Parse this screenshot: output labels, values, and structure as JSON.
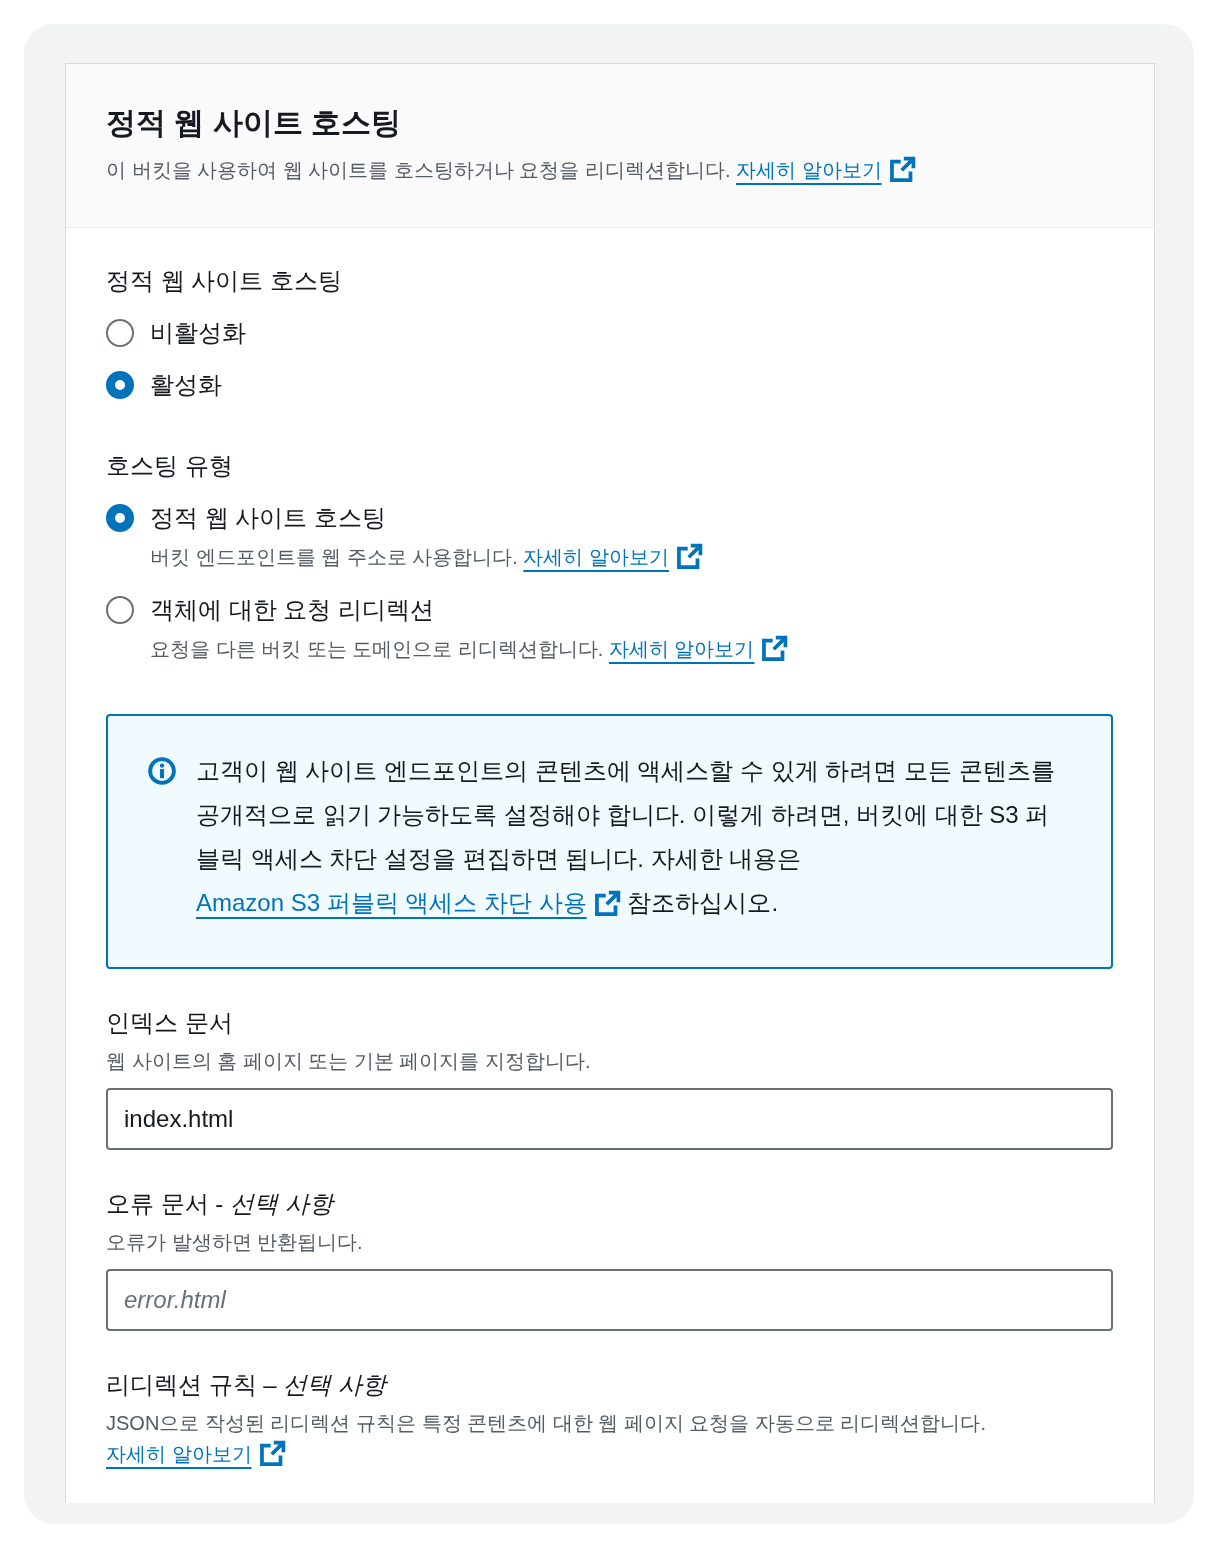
{
  "header": {
    "title": "정적 웹 사이트 호스팅",
    "description": "이 버킷을 사용하여 웹 사이트를 호스팅하거나 요청을 리디렉션합니다.",
    "link": "자세히 알아보기"
  },
  "hosting": {
    "label": "정적 웹 사이트 호스팅",
    "options": [
      {
        "label": "비활성화",
        "selected": false
      },
      {
        "label": "활성화",
        "selected": true
      }
    ]
  },
  "hosting_type": {
    "label": "호스팅 유형",
    "options": [
      {
        "label": "정적 웹 사이트 호스팅",
        "description": "버킷 엔드포인트를 웹 주소로 사용합니다.",
        "link": "자세히 알아보기",
        "selected": true
      },
      {
        "label": "객체에 대한 요청 리디렉션",
        "description": "요청을 다른 버킷 또는 도메인으로 리디렉션합니다.",
        "link": "자세히 알아보기",
        "selected": false
      }
    ]
  },
  "info_alert": {
    "text": "고객이 웹 사이트 엔드포인트의 콘텐츠에 액세스할 수 있게 하려면 모든 콘텐츠를 공개적으로 읽기 가능하도록 설정해야 합니다. 이렇게 하려면, 버킷에 대한 S3 퍼블릭 액세스 차단 설정을 편집하면 됩니다. 자세한 내용은",
    "link": "Amazon S3 퍼블릭 액세스 차단 사용",
    "text_after": "참조하십시오."
  },
  "index_document": {
    "label": "인덱스 문서",
    "description": "웹 사이트의 홈 페이지 또는 기본 페이지를 지정합니다.",
    "value": "index.html"
  },
  "error_document": {
    "label": "오류 문서 - *선택 사항*",
    "description": "오류가 발생하면 반환됩니다.",
    "placeholder": "error.html"
  },
  "redirection_rules": {
    "label": "리디렉션 규칙 – *선택 사항*",
    "description": "JSON으로 작성된 리디렉션 규칙은 특정 콘텐츠에 대한 웹 페이지 요청을 자동으로 리디렉션합니다.",
    "link": "자세히 알아보기"
  }
}
